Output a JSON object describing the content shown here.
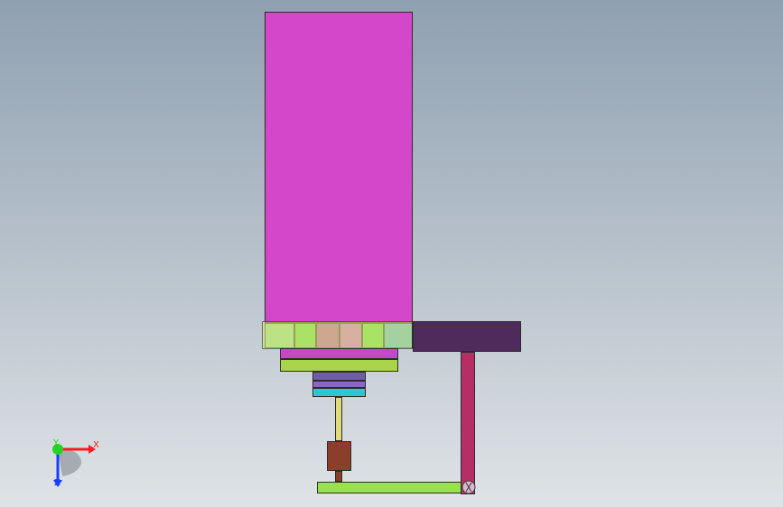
{
  "viewport": {
    "background": {
      "top_color": "#8fa0b1",
      "bottom_color": "#dfe3e6"
    }
  },
  "colors": {
    "motor": "#d447cb",
    "left_block": "#95d49a",
    "left_green_block": "#63d34a",
    "center_pink_block": "#c040b8",
    "center_light_pink_block": "#da57e6",
    "right_green_block": "#64d64a",
    "blue_block": "#58a9df",
    "bracket": "#4f2b5d",
    "yellow_plate": "#d8ec78",
    "pink_disc": "#c847c5",
    "green_disc": "#aad54a",
    "purple_upper_block": "#6e5ea8",
    "purple_lower_block": "#8b67c3",
    "cyan_block": "#2cc6d4",
    "shaft": "#dedb7c",
    "brown_sleeve": "#8b3f2a",
    "crank_arm": "#98e24c",
    "red_rod": "#b52f66",
    "pivot": "#d8b8cf",
    "triad_x": "#ff1a1a",
    "triad_y": "#24d324",
    "triad_z": "#1a3dff",
    "triad_plane": "#9ca2a8"
  },
  "triad": {
    "labels": {
      "x": "X",
      "y": "Y",
      "z": "Z"
    }
  }
}
